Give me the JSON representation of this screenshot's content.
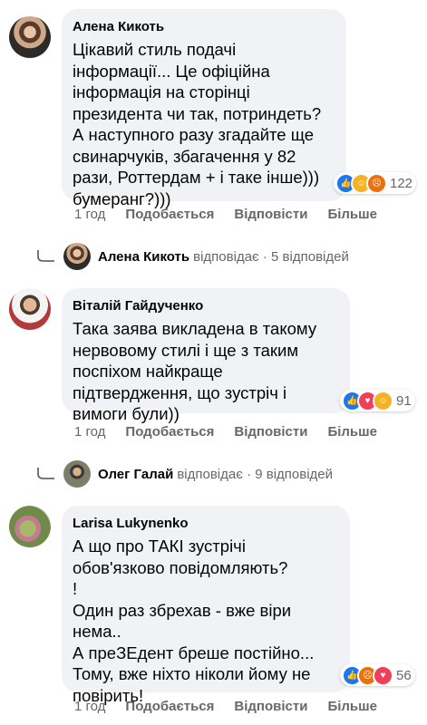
{
  "comments": [
    {
      "author": "Алена Кикоть",
      "text": "Цікавий стиль подачі\nінформації... Це офіційна\nінформація на сторінці\nпрезидента чи так, потриндеть?\nА наступного разу згадайте ще\nсвинарчуків, збагачення у 82\nрази, Роттердам + і таке інше)))\nбумеранг?)))",
      "reaction_count": "122",
      "time": "1 год",
      "like": "Подобається",
      "reply": "Відповісти",
      "more": "Більше"
    },
    {
      "author": "Віталій Гайдученко",
      "text": "Така заява викладена в такому\nнервовому стилі і ще з таким\nпоспіхом найкраще\nпідтвердження, що зустріч і\nвимоги були))",
      "reaction_count": "91",
      "time": "1 год",
      "like": "Подобається",
      "reply": "Відповісти",
      "more": "Більше"
    },
    {
      "author": "Larisa Lukynenko",
      "text": "А що про ТАКІ зустрічі\nобов'язково повідомляють?\n!\nОдин раз збрехав - вже віри\nнема..\nА преЗЕдент бреше постійно...\nТому, вже ніхто ніколи йому не\nповірить!",
      "reaction_count": "56",
      "time": "1 год",
      "like": "Подобається",
      "reply": "Відповісти",
      "more": "Більше"
    }
  ],
  "replies": [
    {
      "name": "Алена Кикоть",
      "verb": "відповідає",
      "count": "· 5 відповідей"
    },
    {
      "name": "Олег Галай",
      "verb": "відповідає",
      "count": "· 9 відповідей"
    }
  ],
  "colors": {
    "bubble": "#f0f2f5",
    "meta": "#65676b",
    "like": "#1877f2"
  }
}
